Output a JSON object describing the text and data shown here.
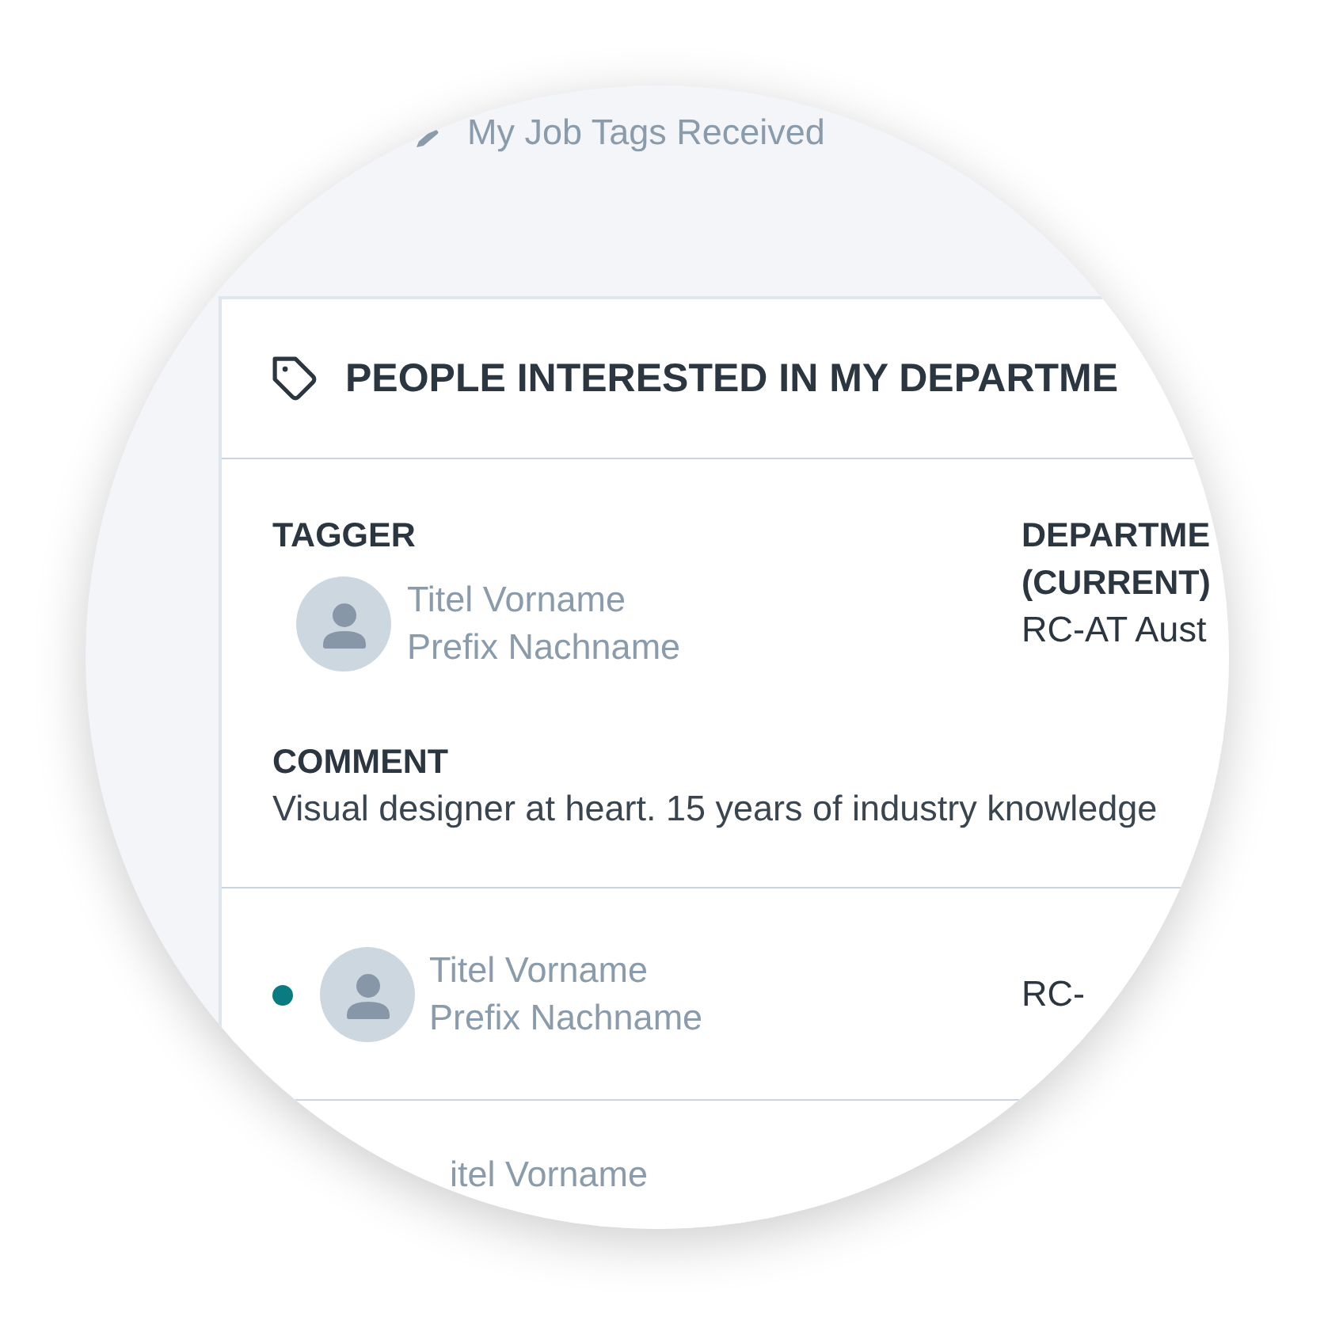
{
  "nav": {
    "label": "My Job Tags Received"
  },
  "card": {
    "title": "PEOPLE INTERESTED IN MY DEPARTME",
    "rows": [
      {
        "kind": "detail",
        "tagger_label": "TAGGER",
        "name_line_1": "Titel Vorname",
        "name_line_2": "Prefix Nachname",
        "department_label": "DEPARTME\n(CURRENT)",
        "department": "RC-AT Aust",
        "comment_label": "COMMENT",
        "comment": "Visual designer at heart. 15 years of industry knowledge"
      },
      {
        "kind": "summary",
        "unread": true,
        "name_line_1": "Titel Vorname",
        "name_line_2": "Prefix Nachname",
        "department": "RC-"
      },
      {
        "kind": "name_only",
        "name_line_1": "itel Vorname"
      }
    ]
  }
}
